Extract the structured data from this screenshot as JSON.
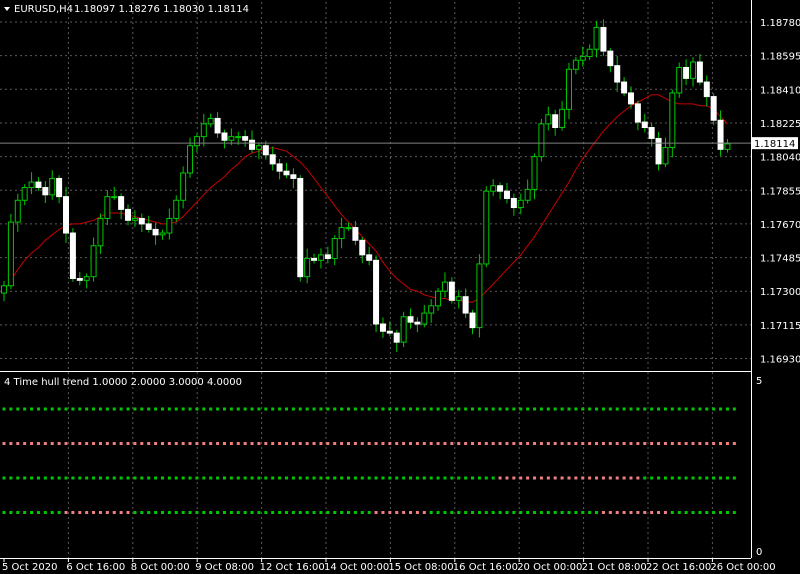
{
  "header": {
    "symbol": "EURUSD,H4",
    "ohlc": "1.18097 1.18276 1.18030 1.18114"
  },
  "indicator": {
    "title": "4 Time hull trend 1.0000 2.0000 3.0000 4.0000",
    "scale_max": "5",
    "scale_min": "0"
  },
  "colors": {
    "background": "#000000",
    "grid": "#5a5a5a",
    "bull": "#000000",
    "bull_outline": "#00c800",
    "bear": "#ffffff",
    "ma": "#c80000",
    "up": "#00c800",
    "down": "#f08080",
    "current_price_line": "#808080"
  },
  "chart_data": [
    {
      "type": "candlestick",
      "symbol": "EURUSD",
      "timeframe": "H4",
      "y_ticks": [
        "1.18780",
        "1.18595",
        "1.18410",
        "1.18225",
        "1.18040",
        "1.17855",
        "1.17670",
        "1.17485",
        "1.17300",
        "1.17115",
        "1.16930"
      ],
      "current_price": "1.18114",
      "ylim": [
        1.1685,
        1.1885
      ],
      "x_ticks": [
        "5 Oct 2020",
        "6 Oct 16:00",
        "8 Oct 00:00",
        "9 Oct 08:00",
        "12 Oct 16:00",
        "14 Oct 00:00",
        "15 Oct 08:00",
        "16 Oct 16:00",
        "20 Oct 00:00",
        "21 Oct 08:00",
        "22 Oct 16:00",
        "26 Oct 00:00"
      ],
      "close": [
        1.1733,
        1.1768,
        1.178,
        1.1787,
        1.179,
        1.1787,
        1.1783,
        1.1792,
        1.1782,
        1.1762,
        1.1737,
        1.1736,
        1.1738,
        1.1755,
        1.177,
        1.1782,
        1.1782,
        1.1775,
        1.1769,
        1.177,
        1.1767,
        1.1764,
        1.1761,
        1.1762,
        1.177,
        1.178,
        1.1795,
        1.181,
        1.1815,
        1.1822,
        1.1825,
        1.1817,
        1.1813,
        1.1815,
        1.1815,
        1.1813,
        1.1808,
        1.181,
        1.1805,
        1.18,
        1.1796,
        1.1794,
        1.1792,
        1.1738,
        1.1748,
        1.1747,
        1.175,
        1.1748,
        1.1759,
        1.1765,
        1.1765,
        1.1758,
        1.175,
        1.1747,
        1.1712,
        1.1708,
        1.1707,
        1.1702,
        1.1716,
        1.1713,
        1.1712,
        1.1718,
        1.1722,
        1.173,
        1.1735,
        1.1725,
        1.1727,
        1.1718,
        1.171,
        1.1745,
        1.1785,
        1.1788,
        1.1785,
        1.1781,
        1.1776,
        1.178,
        1.1786,
        1.1804,
        1.1822,
        1.1827,
        1.182,
        1.183,
        1.1852,
        1.1857,
        1.1859,
        1.1863,
        1.1875,
        1.1862,
        1.1854,
        1.1845,
        1.1839,
        1.1833,
        1.1823,
        1.182,
        1.1814,
        1.18,
        1.1809,
        1.1839,
        1.1853,
        1.1847,
        1.1856,
        1.1845,
        1.1837,
        1.1824,
        1.1808,
        1.1811
      ],
      "ma": [
        1.173,
        1.1736,
        1.1742,
        1.1747,
        1.1751,
        1.1754,
        1.1758,
        1.1761,
        1.1764,
        1.1766,
        1.1767,
        1.1767,
        1.1768,
        1.1769,
        1.1771,
        1.1773,
        1.1773,
        1.1773,
        1.1772,
        1.1771,
        1.177,
        1.1769,
        1.1768,
        1.1767,
        1.1767,
        1.1768,
        1.1771,
        1.1775,
        1.1779,
        1.1783,
        1.1787,
        1.179,
        1.1793,
        1.1797,
        1.18,
        1.1804,
        1.1806,
        1.1807,
        1.1808,
        1.1809,
        1.1808,
        1.1807,
        1.1804,
        1.1801,
        1.1797,
        1.1792,
        1.1787,
        1.1782,
        1.1777,
        1.1772,
        1.1768,
        1.1764,
        1.176,
        1.1756,
        1.1752,
        1.1746,
        1.1741,
        1.1737,
        1.1734,
        1.1731,
        1.173,
        1.1728,
        1.1727,
        1.1726,
        1.1726,
        1.1725,
        1.1725,
        1.1724,
        1.1724,
        1.1726,
        1.173,
        1.1734,
        1.1738,
        1.1742,
        1.1746,
        1.175,
        1.1755,
        1.176,
        1.1766,
        1.1772,
        1.1778,
        1.1784,
        1.179,
        1.1797,
        1.1803,
        1.1808,
        1.1813,
        1.1818,
        1.1822,
        1.1826,
        1.1829,
        1.1832,
        1.1834,
        1.1836,
        1.1838,
        1.1838,
        1.1836,
        1.1834,
        1.1833,
        1.1833,
        1.1833,
        1.1832,
        1.1832,
        1.183,
        1.1826,
        1.1822
      ]
    },
    {
      "type": "dot-rows",
      "title": "4 Time hull trend 1.0000 2.0000 3.0000 4.0000",
      "ylim": [
        0,
        5
      ],
      "rows": [
        {
          "level": 4,
          "segments": [
            {
              "from": 0,
              "to": 106,
              "state": "up"
            }
          ]
        },
        {
          "level": 3,
          "segments": [
            {
              "from": 0,
              "to": 106,
              "state": "down"
            }
          ]
        },
        {
          "level": 2,
          "segments": [
            {
              "from": 0,
              "to": 71,
              "state": "up"
            },
            {
              "from": 72,
              "to": 92,
              "state": "down"
            },
            {
              "from": 93,
              "to": 106,
              "state": "up"
            }
          ]
        },
        {
          "level": 1,
          "segments": [
            {
              "from": 0,
              "to": 8,
              "state": "up"
            },
            {
              "from": 9,
              "to": 18,
              "state": "down"
            },
            {
              "from": 19,
              "to": 53,
              "state": "up"
            },
            {
              "from": 54,
              "to": 61,
              "state": "down"
            },
            {
              "from": 62,
              "to": 86,
              "state": "up"
            },
            {
              "from": 87,
              "to": 96,
              "state": "down"
            },
            {
              "from": 97,
              "to": 106,
              "state": "up"
            }
          ]
        }
      ]
    }
  ]
}
